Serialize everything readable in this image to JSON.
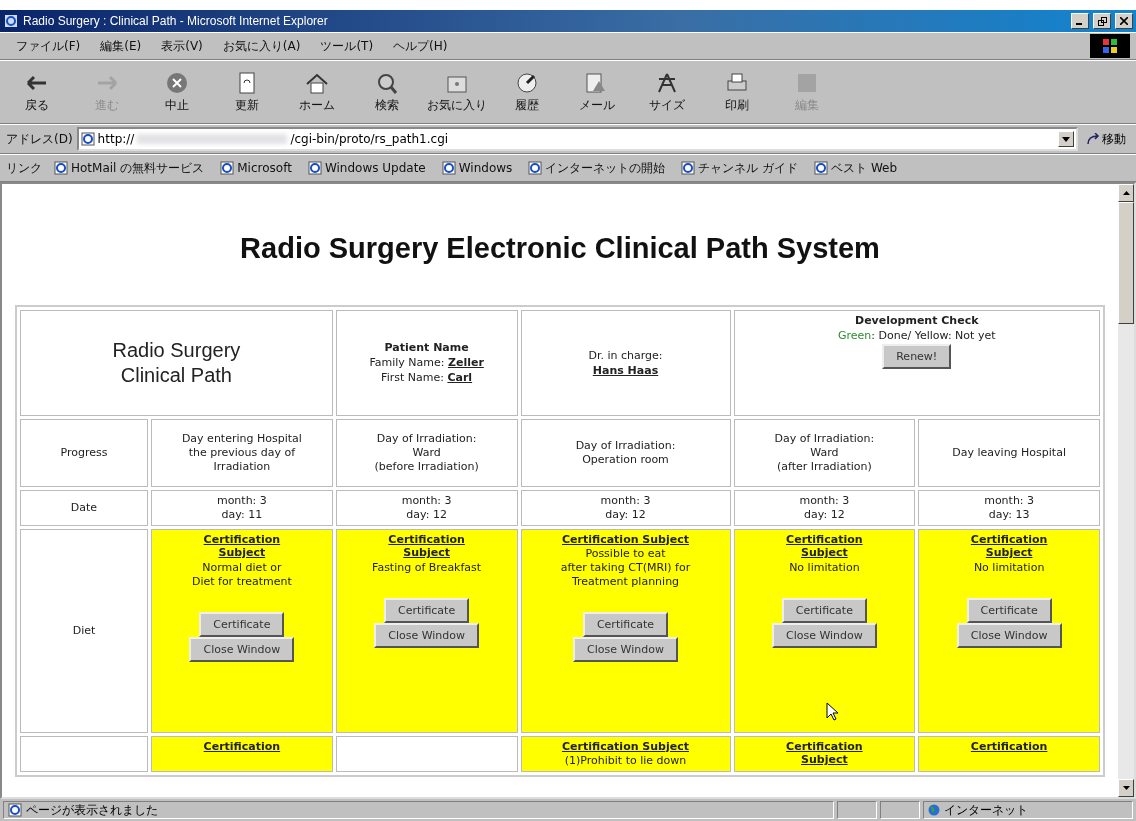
{
  "window": {
    "title": "Radio Surgery : Clinical Path - Microsoft Internet Explorer"
  },
  "menu": [
    "ファイル(F)",
    "編集(E)",
    "表示(V)",
    "お気に入り(A)",
    "ツール(T)",
    "ヘルプ(H)"
  ],
  "toolbar": [
    {
      "label": "戻る",
      "disabled": false
    },
    {
      "label": "進む",
      "disabled": true
    },
    {
      "label": "中止",
      "disabled": false
    },
    {
      "label": "更新",
      "disabled": false
    },
    {
      "label": "ホーム",
      "disabled": false
    },
    {
      "label": "検索",
      "disabled": false
    },
    {
      "label": "お気に入り",
      "disabled": false
    },
    {
      "label": "履歴",
      "disabled": false
    },
    {
      "label": "メール",
      "disabled": false
    },
    {
      "label": "サイズ",
      "disabled": false
    },
    {
      "label": "印刷",
      "disabled": false
    },
    {
      "label": "編集",
      "disabled": true
    }
  ],
  "address": {
    "label": "アドレス(D)",
    "url_start": "http://",
    "url_end": "/cgi-bin/proto/rs_path1.cgi",
    "go": "移動"
  },
  "links": {
    "label": "リンク",
    "items": [
      "HotMail の無料サービス",
      "Microsoft",
      "Windows Update",
      "Windows",
      "インターネットの開始",
      "チャンネル ガイド",
      "ベスト Web"
    ]
  },
  "page": {
    "heading": "Radio Surgery Electronic Clinical Path System",
    "path_title": "Radio Surgery Clinical Path",
    "patient": {
      "heading": "Patient Name",
      "family_label": "Family Name:",
      "family": "Zeller",
      "first_label": "First Name:",
      "first": "Carl"
    },
    "doctor": {
      "label": "Dr. in charge:",
      "name": "Hans Haas"
    },
    "dev_check": {
      "title": "Development Check",
      "legend": [
        {
          "text": "Green",
          "color": "#2e8b2e"
        },
        {
          "text": ": Done/ Yellow: Not yet",
          "color": "#222222"
        }
      ],
      "button": "Renew!"
    },
    "progress": {
      "label": "Progress",
      "cells": [
        "Day entering Hospital\nthe previous day of\nIrradiation",
        "Day of Irradiation:\nWard\n(before Irradiation)",
        "Day of Irradiation:\nOperation room",
        "Day of Irradiation:\nWard\n(after Irradiation)",
        "Day leaving Hospital"
      ]
    },
    "dates": {
      "label": "Date",
      "cells": [
        "month: 3\nday: 11",
        "month: 3\nday: 12",
        "month: 3\nday: 12",
        "month: 3\nday: 12",
        "month: 3\nday: 13"
      ]
    },
    "rows": [
      {
        "label": "Diet",
        "cells": [
          {
            "kind": "item",
            "done": false,
            "subject": "Certification\nSubject",
            "text": "Normal diet or\nDiet for treatment",
            "buttons": [
              "Certificate",
              "Close Window"
            ]
          },
          {
            "kind": "item",
            "done": false,
            "subject": "Certification\nSubject",
            "text": "Fasting of Breakfast",
            "buttons": [
              "Certificate",
              "Close Window"
            ]
          },
          {
            "kind": "item",
            "done": false,
            "subject": "Certification Subject",
            "text": "Possible to eat\nafter taking CT(MRI) for\nTreatment planning",
            "buttons": [
              "Certificate",
              "Close Window"
            ]
          },
          {
            "kind": "item",
            "done": false,
            "subject": "Certification\nSubject",
            "text": "No limitation",
            "buttons": [
              "Certificate",
              "Close Window"
            ]
          },
          {
            "kind": "item",
            "done": false,
            "subject": "Certification\nSubject",
            "text": "No limitation",
            "buttons": [
              "Certificate",
              "Close Window"
            ]
          }
        ]
      },
      {
        "cells": [
          {
            "kind": "item",
            "done": false,
            "subject": "Certification"
          },
          {
            "kind": "empty"
          },
          {
            "kind": "item",
            "done": false,
            "subject": "Certification Subject",
            "text": "(1)Prohibit to lie down"
          },
          {
            "kind": "item",
            "done": false,
            "subject": "Certification\nSubject"
          },
          {
            "kind": "item",
            "done": false,
            "subject": "Certification"
          }
        ]
      }
    ]
  },
  "status_bar": {
    "text": "ページが表示されました",
    "zone": "インターネット"
  }
}
